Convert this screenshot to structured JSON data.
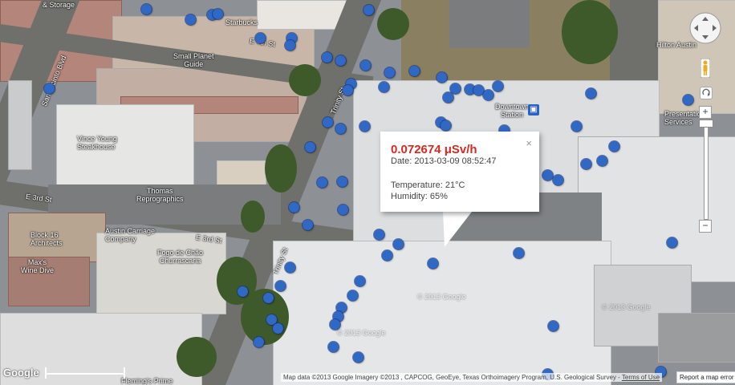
{
  "info_window": {
    "reading": "0.072674 μSv/h",
    "date": "Date: 2013-03-09 08:52:47",
    "temperature": "Temperature: 21°C",
    "humidity": "Humidity: 65%",
    "close_glyph": "×"
  },
  "map_labels": {
    "storage": "& Storage",
    "starbucks": "Starbucks",
    "e_4th_st": "E 4th St",
    "small_planet_line1": "Small Planet",
    "small_planet_line2": "Guide",
    "san_jacinto": "San Jacinto Blvd",
    "trinity_st_top": "Trinity St",
    "downtown_station_line1": "Downtown",
    "downtown_station_line2": "Station",
    "hilton": "Hilton Austin",
    "presentation_line1": "Presentation",
    "presentation_line2": "Services",
    "vince_young_line1": "Vince Young",
    "vince_young_line2": "Steakhouse",
    "thomas_line1": "Thomas",
    "thomas_line2": "Reprographics",
    "e_3rd_st_left": "E 3rd St",
    "e_3rd_st_mid": "E 3rd St",
    "block16_line1": "Block 16",
    "block16_line2": "Architects",
    "austin_carriage_line1": "Austin Carriage",
    "austin_carriage_line2": "Company",
    "fogo_line1": "Fogo de Chão",
    "fogo_line2": "Churrascaria",
    "maxs_line1": "Max's",
    "maxs_line2": "Wine Dive",
    "trinity_st_bottom": "Trinity St",
    "flemings": "Fleming's Prime",
    "google_ghost1": "© 2013 Google",
    "google_ghost2": "© 2013 Google",
    "google_ghost3": "© 2013 Google"
  },
  "controls": {
    "zoom_in": "+",
    "zoom_out": "−"
  },
  "footer": {
    "logo": "Google",
    "attribution": "Map data ©2013 Google Imagery ©2013 , CAPCOG, GeoEye, Texas Orthoimagery Program, U.S. Geological Survey - ",
    "terms": "Terms of Use",
    "report": "Report a map error"
  },
  "colors": {
    "marker": "#2f68c5",
    "reading_text": "#d9281f"
  }
}
